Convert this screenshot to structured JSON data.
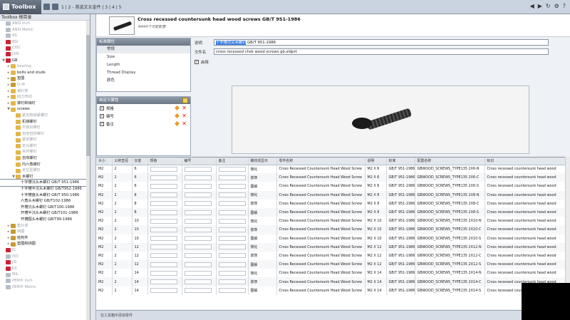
{
  "app": {
    "title": "Toolbox"
  },
  "toolbar": {
    "pages": "1 | 2 - 首选文五金件 | 3 | 4 | 5"
  },
  "tree": {
    "header": "Toolbox 根目录",
    "items": [
      {
        "label": "ANSI Inch",
        "dim": true,
        "indent": 0,
        "icon": "grey"
      },
      {
        "label": "ANSI Metric",
        "dim": true,
        "indent": 0,
        "icon": "grey"
      },
      {
        "label": "AS",
        "dim": true,
        "indent": 0,
        "icon": "grey"
      },
      {
        "label": "BSI",
        "dim": true,
        "indent": 0,
        "icon": "flag"
      },
      {
        "label": "CISC",
        "dim": true,
        "indent": 0,
        "icon": "flag"
      },
      {
        "label": "DIN",
        "dim": true,
        "indent": 0,
        "icon": "flag"
      },
      {
        "label": "GB",
        "dim": false,
        "indent": 0,
        "icon": "flag",
        "exp": "▼"
      },
      {
        "label": "bearing",
        "dim": true,
        "indent": 1,
        "icon": "folder",
        "exp": "▸"
      },
      {
        "label": "bolts and studs",
        "dim": false,
        "indent": 1,
        "icon": "folder",
        "exp": "▸"
      },
      {
        "label": "垫圈",
        "dim": false,
        "indent": 1,
        "icon": "gear",
        "exp": "▸"
      },
      {
        "label": "O-环",
        "dim": true,
        "indent": 1,
        "icon": "gear",
        "exp": "▸"
      },
      {
        "label": "销钉类",
        "dim": true,
        "indent": 1,
        "icon": "folder",
        "exp": "▸"
      },
      {
        "label": "动力传动",
        "dim": true,
        "indent": 1,
        "icon": "folder",
        "exp": "▸"
      },
      {
        "label": "铆钉和销钉",
        "dim": false,
        "indent": 1,
        "icon": "folder",
        "exp": "▸"
      },
      {
        "label": "screws",
        "dim": false,
        "indent": 1,
        "icon": "folder",
        "exp": "▼"
      },
      {
        "label": "紧定和锁紧螺钉",
        "dim": true,
        "indent": 2,
        "icon": "folder"
      },
      {
        "label": "机械螺钉",
        "dim": false,
        "indent": 2,
        "icon": "folder"
      },
      {
        "label": "不脱出螺钉",
        "dim": true,
        "indent": 2,
        "icon": "folder"
      },
      {
        "label": "自攻自挤螺钉",
        "dim": true,
        "indent": 2,
        "icon": "folder"
      },
      {
        "label": "紧定螺钉",
        "dim": true,
        "indent": 2,
        "icon": "folder"
      },
      {
        "label": "无头螺钉",
        "dim": true,
        "indent": 2,
        "icon": "folder"
      },
      {
        "label": "吊环螺钉",
        "dim": true,
        "indent": 2,
        "icon": "folder"
      },
      {
        "label": "自攻螺钉",
        "dim": false,
        "indent": 2,
        "icon": "folder"
      },
      {
        "label": "内六角螺钉",
        "dim": false,
        "indent": 2,
        "icon": "folder"
      },
      {
        "label": "定位型螺钉",
        "dim": true,
        "indent": 2,
        "icon": "folder"
      },
      {
        "label": "木螺钉",
        "dim": false,
        "indent": 2,
        "icon": "folder",
        "exp": "▼"
      },
      {
        "label": "十字槽沉头木螺钉 GB/T 951-1986",
        "dim": false,
        "indent": 3,
        "icon": "none",
        "selected": true
      },
      {
        "label": "十字槽半沉头木螺钉 GB/T952-1986",
        "dim": false,
        "indent": 3,
        "icon": "none"
      },
      {
        "label": "十字槽盘头木螺钉 GB/T 950-1986",
        "dim": false,
        "indent": 3,
        "icon": "none"
      },
      {
        "label": "六角头木螺钉 GB/T102-1986",
        "dim": false,
        "indent": 3,
        "icon": "none"
      },
      {
        "label": "开槽沉头木螺钉 GB/T100-1986",
        "dim": false,
        "indent": 3,
        "icon": "none"
      },
      {
        "label": "开槽半沉头木螺钉 GB/T101-1986",
        "dim": false,
        "indent": 3,
        "icon": "none"
      },
      {
        "label": "开槽圆头木螺钉 GB/T99-1986",
        "dim": false,
        "indent": 3,
        "icon": "none"
      },
      {
        "label": "垫片类",
        "dim": true,
        "indent": 1,
        "icon": "gear",
        "exp": "▸"
      },
      {
        "label": "挡圈",
        "dim": true,
        "indent": 1,
        "icon": "gear",
        "exp": "▸"
      },
      {
        "label": "结构件",
        "dim": false,
        "indent": 1,
        "icon": "gear",
        "exp": "▸"
      },
      {
        "label": "垫圈和挡圈",
        "dim": false,
        "indent": 1,
        "icon": "gear",
        "exp": "▸"
      },
      {
        "label": "IS",
        "dim": true,
        "indent": 0,
        "icon": "flag"
      },
      {
        "label": "ISO",
        "dim": true,
        "indent": 0,
        "icon": "grey"
      },
      {
        "label": "JIS",
        "dim": true,
        "indent": 0,
        "icon": "flag"
      },
      {
        "label": "KS",
        "dim": true,
        "indent": 0,
        "icon": "flag"
      },
      {
        "label": "MIL",
        "dim": true,
        "indent": 0,
        "icon": "grey"
      },
      {
        "label": "PEM® Inch",
        "dim": true,
        "indent": 0,
        "icon": "grey"
      },
      {
        "label": "PEM® Metric",
        "dim": true,
        "indent": 0,
        "icon": "grey"
      }
    ]
  },
  "part": {
    "title": "Cross recessed countersunk head wood screws GB/T 951-1986",
    "subtitle": "共444个可配配置"
  },
  "properties_panel": {
    "title": "标准属性",
    "items": [
      "常规",
      "Size",
      "Length",
      "Thread Display",
      "颜色"
    ]
  },
  "custom_panel": {
    "title": "自定义属性",
    "items": [
      "规格",
      "编号",
      "备注"
    ]
  },
  "fields": {
    "description_label": "说明",
    "description_highlight": "十字槽沉头木螺钉",
    "description_rest": " GB/T 951-1986",
    "filename_label": "文件名",
    "filename_value": "cross recessed chsk wood screws gb.sldprt",
    "enable_label": "启用"
  },
  "grid": {
    "columns": [
      "大小",
      "公称直径",
      "长度",
      "规格",
      "编号",
      "备注",
      "螺纹线显示",
      "零件名称",
      "说明",
      "标准",
      "配置名称",
      "标识"
    ],
    "rows": [
      [
        "M2",
        "2",
        "6",
        "",
        "",
        "",
        "微化",
        "Cross Recessed Countersunk Head Wood Screw",
        "M2 X 6",
        "GB/T 951-1986",
        "GBWOOD_SCREWS_TYPE135 2X6-N",
        "Cross recessed countersunk head wood"
      ],
      [
        "M2",
        "2",
        "6",
        "",
        "",
        "",
        "装饰",
        "Cross Recessed Countersunk Head Wood Screw",
        "M2 X 6",
        "GB/T 951-1986",
        "GBWOOD_SCREWS_TYPE135 2X6-C",
        "Cross recessed countersunk head wood"
      ],
      [
        "M2",
        "2",
        "6",
        "",
        "",
        "",
        "图解",
        "Cross Recessed Countersunk Head Wood Screw",
        "M2 X 6",
        "GB/T 951-1986",
        "GBWOOD_SCREWS_TYPE135 2X6-S",
        "Cross recessed countersunk head wood"
      ],
      [
        "M2",
        "2",
        "8",
        "",
        "",
        "",
        "微化",
        "Cross Recessed Countersunk Head Wood Screw",
        "M2 X 8",
        "GB/T 951-1986",
        "GBWOOD_SCREWS_TYPE135 2X8-N",
        "Cross recessed countersunk head wood"
      ],
      [
        "M2",
        "2",
        "8",
        "",
        "",
        "",
        "装饰",
        "Cross Recessed Countersunk Head Wood Screw",
        "M2 X 8",
        "GB/T 951-1986",
        "GBWOOD_SCREWS_TYPE135 2X8-C",
        "Cross recessed countersunk head wood"
      ],
      [
        "M2",
        "2",
        "8",
        "",
        "",
        "",
        "图解",
        "Cross Recessed Countersunk Head Wood Screw",
        "M2 X 8",
        "GB/T 951-1986",
        "GBWOOD_SCREWS_TYPE135 2X8-S",
        "Cross recessed countersunk head wood"
      ],
      [
        "M2",
        "2",
        "10",
        "",
        "",
        "",
        "微化",
        "Cross Recessed Countersunk Head Wood Screw",
        "M2 X 10",
        "GB/T 951-1986",
        "GBWOOD_SCREWS_TYPE135 2X10-N",
        "Cross recessed countersunk head wood"
      ],
      [
        "M2",
        "2",
        "10",
        "",
        "",
        "",
        "装饰",
        "Cross Recessed Countersunk Head Wood Screw",
        "M2 X 10",
        "GB/T 951-1986",
        "GBWOOD_SCREWS_TYPE135 2X10-C",
        "Cross recessed countersunk head wood"
      ],
      [
        "M2",
        "2",
        "10",
        "",
        "",
        "",
        "图解",
        "Cross Recessed Countersunk Head Wood Screw",
        "M2 X 10",
        "GB/T 951-1986",
        "GBWOOD_SCREWS_TYPE135 2X10-S",
        "Cross recessed countersunk head wood"
      ],
      [
        "M2",
        "2",
        "12",
        "",
        "",
        "",
        "微化",
        "Cross Recessed Countersunk Head Wood Screw",
        "M2 X 12",
        "GB/T 951-1986",
        "GBWOOD_SCREWS_TYPE135 2X12-N",
        "Cross recessed countersunk head wood"
      ],
      [
        "M2",
        "2",
        "12",
        "",
        "",
        "",
        "装饰",
        "Cross Recessed Countersunk Head Wood Screw",
        "M2 X 12",
        "GB/T 951-1986",
        "GBWOOD_SCREWS_TYPE135 2X12-C",
        "Cross recessed countersunk head wood"
      ],
      [
        "M2",
        "2",
        "12",
        "",
        "",
        "",
        "图解",
        "Cross Recessed Countersunk Head Wood Screw",
        "M2 X 12",
        "GB/T 951-1986",
        "GBWOOD_SCREWS_TYPE135 2X12-S",
        "Cross recessed countersunk head wood"
      ],
      [
        "M2",
        "2",
        "14",
        "",
        "",
        "",
        "微化",
        "Cross Recessed Countersunk Head Wood Screw",
        "M2 X 14",
        "GB/T 951-1986",
        "GBWOOD_SCREWS_TYPE135 2X14-N",
        "Cross recessed countersunk head wood"
      ],
      [
        "M2",
        "2",
        "14",
        "",
        "",
        "",
        "装饰",
        "Cross Recessed Countersunk Head Wood Screw",
        "M2 X 14",
        "GB/T 951-1986",
        "GBWOOD_SCREWS_TYPE135 2X14-C",
        "Cross recessed countersunk head wood"
      ],
      [
        "M2",
        "2",
        "14",
        "",
        "",
        "",
        "图解",
        "Cross Recessed Countersunk Head Wood Screw",
        "M2 X 14",
        "GB/T 951-1986",
        "GBWOOD_SCREWS_TYPE135 2X14-S",
        "Cross recessed countersunk head wood"
      ]
    ]
  },
  "status": {
    "text": "在工具箱中添加零件"
  }
}
